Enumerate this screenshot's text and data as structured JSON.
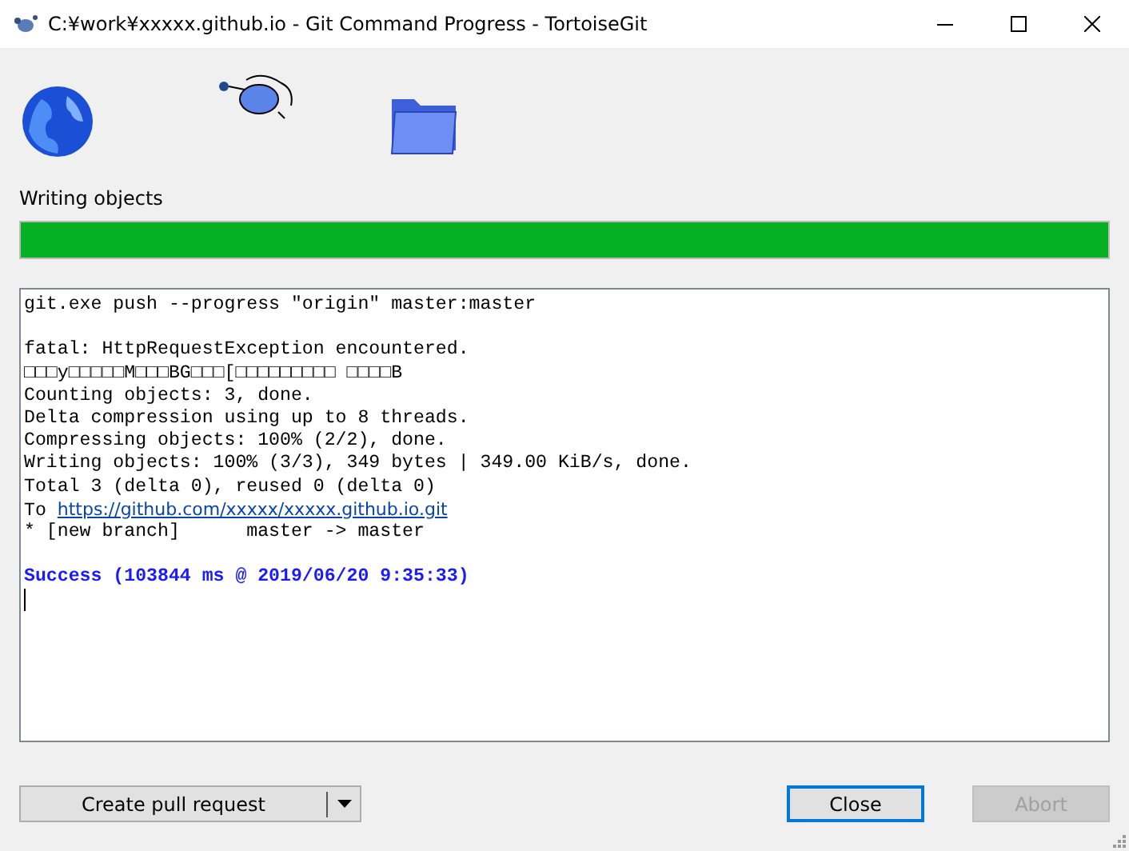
{
  "window": {
    "title": "C:¥work¥xxxxx.github.io - Git Command Progress - TortoiseGit"
  },
  "status": {
    "label": "Writing objects",
    "level": 1
  },
  "log": [
    {
      "kind": "text",
      "text": "git.exe push --progress \"origin\" master:master"
    },
    {
      "kind": "blank"
    },
    {
      "kind": "text",
      "text": "fatal: HttpRequestException encountered."
    },
    {
      "kind": "text",
      "text": "□□□y□□□□□M□□□BG□□□[□□□□□□□□□ □□□□B"
    },
    {
      "kind": "text",
      "text": "Counting objects: 3, done."
    },
    {
      "kind": "text",
      "text": "Delta compression using up to 8 threads."
    },
    {
      "kind": "text",
      "text": "Compressing objects: 100% (2/2), done."
    },
    {
      "kind": "text",
      "text": "Writing objects: 100% (3/3), 349 bytes | 349.00 KiB/s, done."
    },
    {
      "kind": "text",
      "text": "Total 3 (delta 0), reused 0 (delta 0)"
    },
    {
      "kind": "link",
      "text": "To",
      "url": "https://github.com/xxxxx/xxxxx.github.io.git"
    },
    {
      "kind": "text",
      "text": "* [new branch]      master -> master"
    },
    {
      "kind": "blank"
    },
    {
      "kind": "success",
      "text": "Success (103844 ms @ 2019/06/20 9:35:33)"
    }
  ],
  "buttons": [
    {
      "label": "Create pull request",
      "kind": "split",
      "focused": false,
      "disabled": false
    },
    {
      "label": "Close",
      "kind": "plain",
      "focused": true,
      "disabled": false
    },
    {
      "label": "Abort",
      "kind": "plain",
      "focused": false,
      "disabled": true
    }
  ]
}
